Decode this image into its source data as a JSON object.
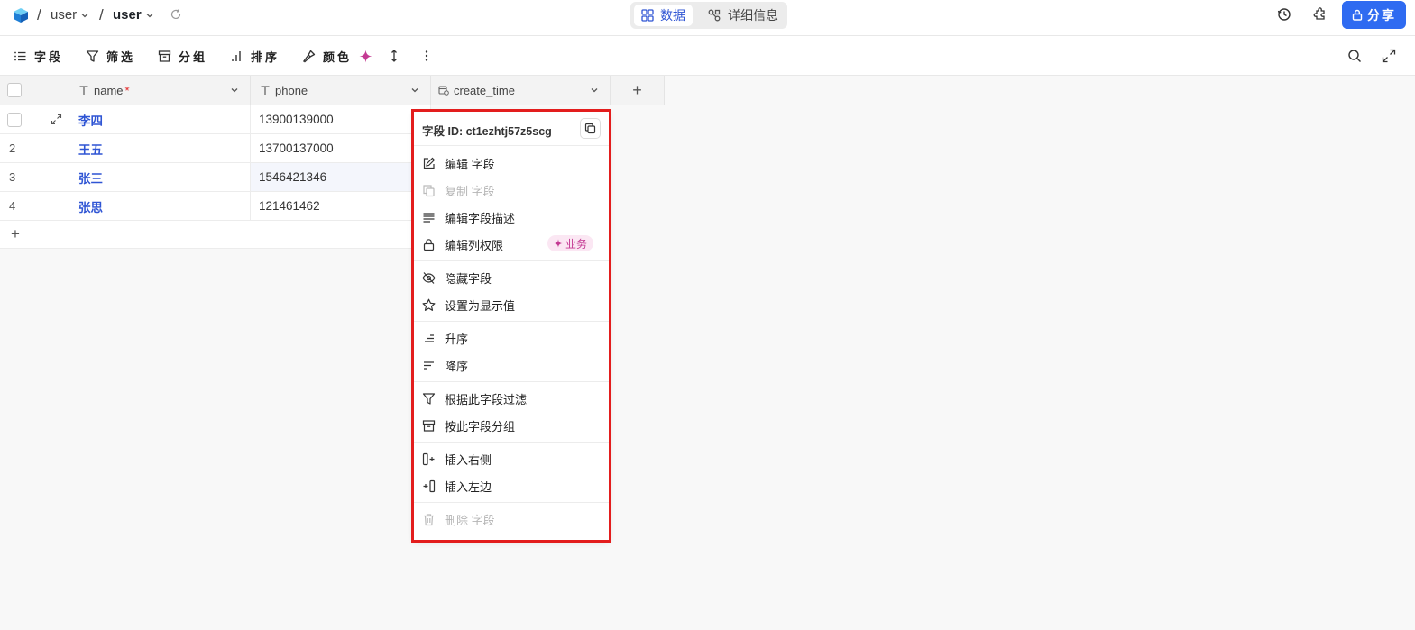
{
  "breadcrumb": {
    "sep": "/",
    "base": "user",
    "table": "user"
  },
  "view_switch": {
    "data_label": "数据",
    "detail_label": "详细信息"
  },
  "header_actions": {
    "share_label": "分享"
  },
  "toolbar": {
    "fields_label": "字段",
    "filter_label": "筛选",
    "group_label": "分组",
    "sort_label": "排序",
    "color_label": "颜色"
  },
  "grid": {
    "columns": [
      {
        "label": "name",
        "required_mark": "*"
      },
      {
        "label": "phone"
      },
      {
        "label": "create_time"
      }
    ],
    "rows": [
      {
        "num": "",
        "name": "李四",
        "phone": "13900139000"
      },
      {
        "num": "2",
        "name": "王五",
        "phone": "13700137000"
      },
      {
        "num": "3",
        "name": "张三",
        "phone": "1546421346"
      },
      {
        "num": "4",
        "name": "张思",
        "phone": "121461462"
      }
    ],
    "add_row": "+",
    "add_col": "+"
  },
  "context_menu": {
    "field_id": "字段 ID: ct1ezhtj57z5scg",
    "items": [
      {
        "label": "编辑 字段"
      },
      {
        "label": "复制 字段"
      },
      {
        "label": "编辑字段描述"
      },
      {
        "label": "编辑列权限"
      },
      {
        "label": "隐藏字段"
      },
      {
        "label": "设置为显示值"
      },
      {
        "label": "升序"
      },
      {
        "label": "降序"
      },
      {
        "label": "根据此字段过滤"
      },
      {
        "label": "按此字段分组"
      },
      {
        "label": "插入右侧"
      },
      {
        "label": "插入左边"
      },
      {
        "label": "删除 字段"
      }
    ],
    "business_badge": "业务"
  },
  "colors": {
    "accent": "#2f55d4",
    "share_bg": "#2f6bf1",
    "highlight_outline": "#e31d1d",
    "badge_text": "#c43a93"
  }
}
